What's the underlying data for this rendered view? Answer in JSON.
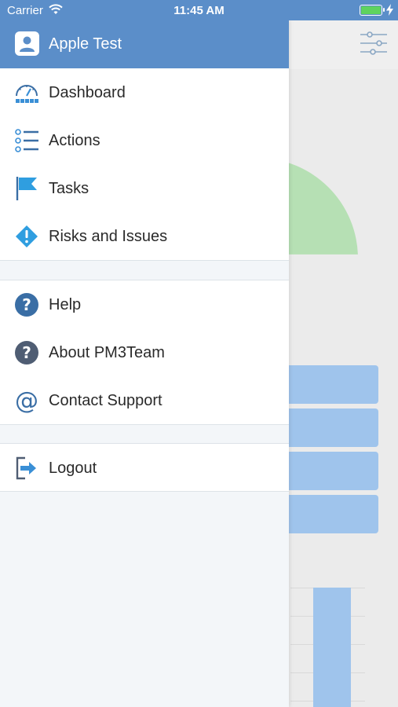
{
  "status_bar": {
    "carrier": "Carrier",
    "time": "11:45 AM"
  },
  "drawer": {
    "header": {
      "title": "Apple Test",
      "icon": "user-icon"
    },
    "main_items": [
      {
        "label": "Dashboard",
        "icon": "dashboard-gauge-icon"
      },
      {
        "label": "Actions",
        "icon": "checklist-icon"
      },
      {
        "label": "Tasks",
        "icon": "flag-icon"
      },
      {
        "label": "Risks and Issues",
        "icon": "warning-diamond-icon"
      }
    ],
    "support_items": [
      {
        "label": "Help",
        "icon": "help-icon"
      },
      {
        "label": "About PM3Team",
        "icon": "about-question-icon"
      },
      {
        "label": "Contact Support",
        "icon": "at-sign-icon"
      }
    ],
    "logout_item": {
      "label": "Logout",
      "icon": "logout-icon"
    }
  },
  "colors": {
    "header_blue": "#5b8ec9",
    "icon_blue": "#3a8fd6",
    "drawer_bg": "#f3f6f9",
    "gauge_green": "#b6e0b4",
    "bar_blue": "#9fc4ec"
  }
}
